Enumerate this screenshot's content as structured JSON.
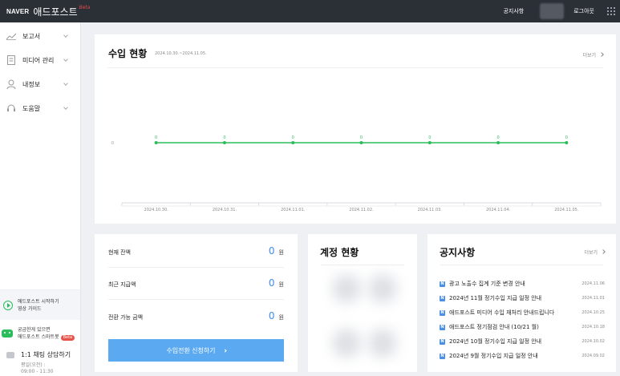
{
  "header": {
    "brand_naver": "NAVER",
    "brand_name": "애드포스트",
    "brand_beta": "Beta",
    "notice_link": "공지사항",
    "logout_link": "로그아웃"
  },
  "sidebar": {
    "items": [
      {
        "label": "보고서",
        "icon": "chart-line-icon"
      },
      {
        "label": "미디어 관리",
        "icon": "document-icon"
      },
      {
        "label": "내정보",
        "icon": "user-icon"
      },
      {
        "label": "도움말",
        "icon": "headset-icon"
      }
    ],
    "guide_line1": "애드포스트 시작하기",
    "guide_line2": "영상 가이드",
    "bot_line1": "궁금한게 있으면",
    "bot_line2": "애드포스트 스마트봇",
    "bot_badge": "Beta",
    "chat_title": "1:1 채팅 상담하기",
    "chat_sub1": "평일(오전) :",
    "chat_sub2": "09:00 - 11:30"
  },
  "revenue": {
    "title": "수입 현황",
    "date_range": "2024.10.30.~2024.11.05.",
    "more": "더보기",
    "y_tick": "0"
  },
  "chart_data": {
    "type": "line",
    "x": [
      "2024.10.30.",
      "2024.10.31.",
      "2024.11.01.",
      "2024.11.02.",
      "2024.11.03.",
      "2024.11.04.",
      "2024.11.05."
    ],
    "series": [
      {
        "values": [
          0,
          0,
          0,
          0,
          0,
          0,
          0
        ],
        "color": "#2bbd5c"
      }
    ],
    "data_labels": [
      "0",
      "0",
      "0",
      "0",
      "0",
      "0",
      "0"
    ],
    "yticks": [
      "0"
    ],
    "grid": false
  },
  "balance": {
    "rows": [
      {
        "label": "현재 잔액",
        "value": "0",
        "unit": "원"
      },
      {
        "label": "최근 지급액",
        "value": "0",
        "unit": "원"
      },
      {
        "label": "전환 가능 금액",
        "value": "0",
        "unit": "원"
      }
    ],
    "button": "수입전환 신청하기"
  },
  "account": {
    "title": "계정 현황"
  },
  "notices": {
    "title": "공지사항",
    "more": "더보기",
    "badge": "N",
    "items": [
      {
        "title": "광고 노출수 집계 기준 변경 안내",
        "date": "2024.11.06"
      },
      {
        "title": "2024년 11월 정기수입 지급 일정 안내",
        "date": "2024.11.01"
      },
      {
        "title": "애드포스트 미디어 수입 재처리 안내드립니다",
        "date": "2024.10.25"
      },
      {
        "title": "애드포스트 정기점검 안내 (10/21 월)",
        "date": "2024.10.18"
      },
      {
        "title": "2024년 10월 정기수입 지급 일정 안내",
        "date": "2024.10.02"
      },
      {
        "title": "2024년 9월 정기수입 지급 일정 안내",
        "date": "2024.09.02"
      }
    ]
  }
}
